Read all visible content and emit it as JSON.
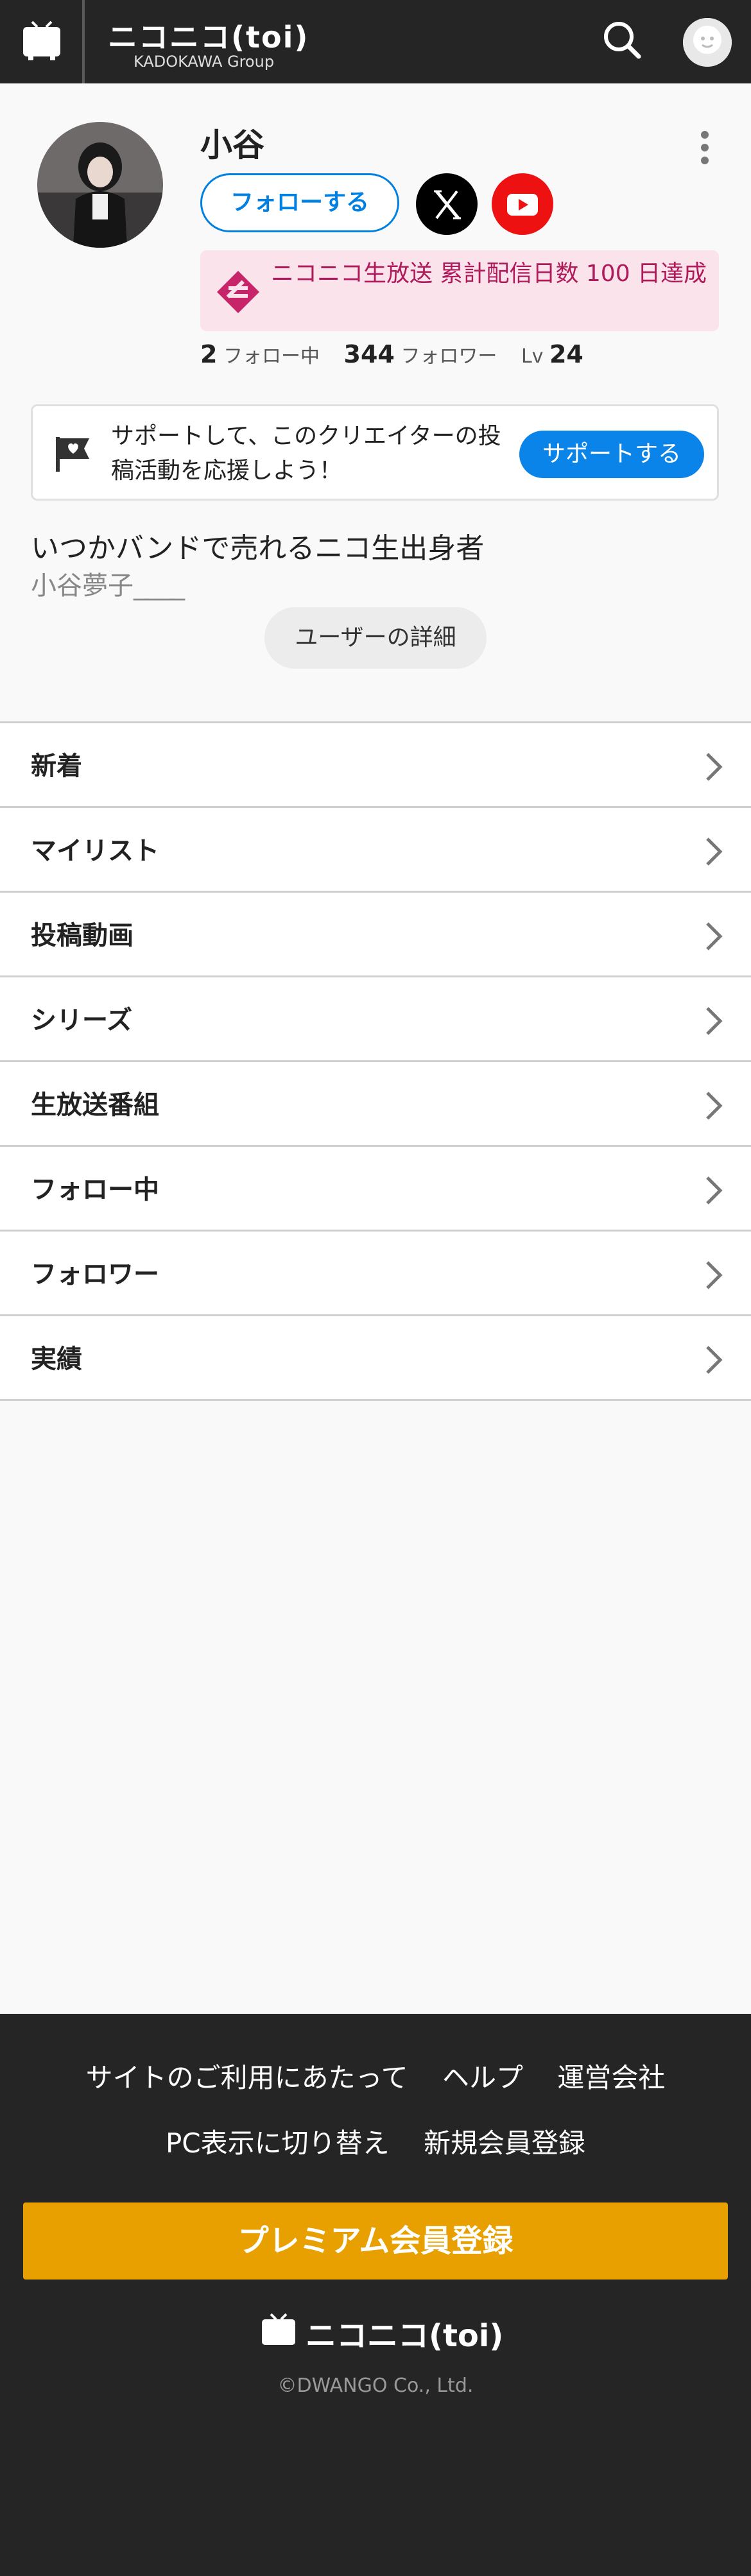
{
  "header": {
    "logo_main": "ニコニコ(toi)",
    "logo_sub": "KADOKAWA Group"
  },
  "profile": {
    "name": "小谷",
    "follow_label": "フォローする",
    "badge_text": "ニコニコ生放送 累計配信日数 100 日達成",
    "stats": {
      "following_count": "2",
      "following_label": "フォロー中",
      "followers_count": "344",
      "followers_label": "フォロワー",
      "level_label": "Lv",
      "level_value": "24"
    },
    "support_text": "サポートして、このクリエイターの投稿活動を応援しよう！",
    "support_button": "サポートする",
    "description_line1": "いつかバンドで売れるニコ生出身者",
    "description_line2": "小谷夢子____",
    "detail_button": "ユーザーの詳細"
  },
  "menu": {
    "items": [
      {
        "label": "新着"
      },
      {
        "label": "マイリスト"
      },
      {
        "label": "投稿動画"
      },
      {
        "label": "シリーズ"
      },
      {
        "label": "生放送番組"
      },
      {
        "label": "フォロー中"
      },
      {
        "label": "フォロワー"
      },
      {
        "label": "実績"
      }
    ]
  },
  "footer": {
    "links_row1": [
      "サイトのご利用にあたって",
      "ヘルプ",
      "運営会社"
    ],
    "links_row2": [
      "PC表示に切り替え",
      "新規会員登録"
    ],
    "premium_button": "プレミアム会員登録",
    "logo_text": "ニコニコ(toi)",
    "copyright": "©DWANGO Co., Ltd."
  },
  "colors": {
    "header_bg": "#252525",
    "accent_blue": "#0a84e8",
    "badge_bg": "#fbe3ec",
    "badge_text": "#b01a5a",
    "premium": "#e8a000"
  },
  "icons": [
    "tv-icon",
    "search-icon",
    "user-avatar-icon",
    "more-vertical-icon",
    "x-logo-icon",
    "youtube-icon",
    "achievement-badge-icon",
    "support-flag-icon",
    "chevron-right-icon"
  ]
}
